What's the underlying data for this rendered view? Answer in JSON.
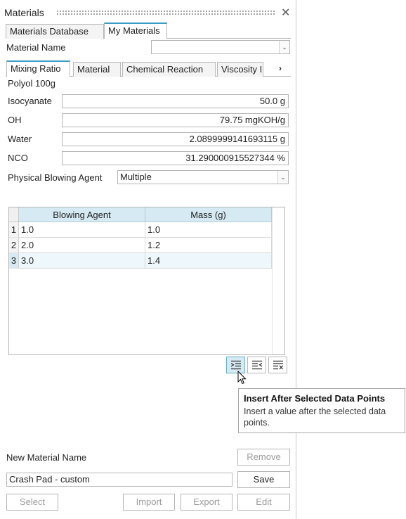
{
  "panel": {
    "title": "Materials"
  },
  "top_tabs": [
    {
      "label": "Materials Database",
      "active": false
    },
    {
      "label": "My Materials",
      "active": true
    }
  ],
  "material_name": {
    "label": "Material Name",
    "value": ""
  },
  "sub_tabs": [
    {
      "label": "Mixing Ratio",
      "active": true
    },
    {
      "label": "Material",
      "active": false
    },
    {
      "label": "Chemical Reaction",
      "active": false
    },
    {
      "label": "Viscosity I",
      "active": false
    }
  ],
  "section_title": "Polyol 100g",
  "props": [
    {
      "label": "Isocyanate",
      "value": "50.0 g"
    },
    {
      "label": "OH",
      "value": "79.75 mgKOH/g"
    },
    {
      "label": "Water",
      "value": "2.0899999141693115 g"
    },
    {
      "label": "NCO",
      "value": "31.290000915527344 %"
    }
  ],
  "blowing_agent": {
    "label": "Physical Blowing Agent",
    "value": "Multiple"
  },
  "table": {
    "columns": [
      "Blowing Agent",
      "Mass (g)"
    ],
    "rows": [
      {
        "num": "1",
        "agent": "1.0",
        "mass": "1.0",
        "selected": false
      },
      {
        "num": "2",
        "agent": "2.0",
        "mass": "1.2",
        "selected": false
      },
      {
        "num": "3",
        "agent": "3.0",
        "mass": "1.4",
        "selected": true
      }
    ]
  },
  "row_actions": [
    "insert-after-icon",
    "insert-before-icon",
    "delete-rows-icon"
  ],
  "tooltip": {
    "title": "Insert After Selected Data Points",
    "description": "Insert a value after the selected data points."
  },
  "new_material": {
    "label": "New Material Name",
    "value": "Crash Pad - custom"
  },
  "buttons": {
    "remove": "Remove",
    "save": "Save",
    "select": "Select",
    "import": "Import",
    "export": "Export",
    "edit": "Edit"
  },
  "colors": {
    "accent": "#3a9bc4",
    "header_bg": "#d6eaf3"
  }
}
